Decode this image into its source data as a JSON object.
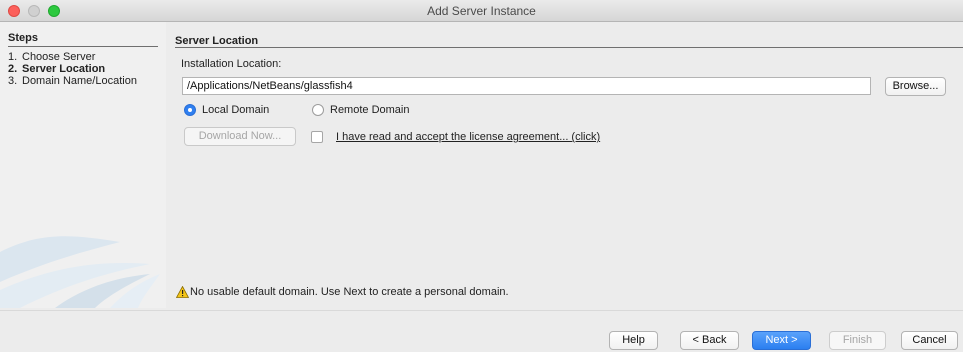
{
  "window": {
    "title": "Add Server Instance"
  },
  "steps": {
    "heading": "Steps",
    "items": [
      {
        "num": "1.",
        "label": "Choose Server"
      },
      {
        "num": "2.",
        "label": "Server Location"
      },
      {
        "num": "3.",
        "label": "Domain Name/Location"
      }
    ],
    "current_index": 1
  },
  "panel": {
    "title": "Server Location",
    "install_label": "Installation Location:",
    "install_path": "/Applications/NetBeans/glassfish4",
    "browse_label": "Browse...",
    "local_domain_label": "Local Domain",
    "remote_domain_label": "Remote Domain",
    "selected_domain": "Local Domain",
    "download_label": "Download Now...",
    "license_link": "I have read and accept the license agreement... (click)",
    "license_accepted": false,
    "warning": "No usable default domain. Use Next to create a personal domain."
  },
  "footer": {
    "help": "Help",
    "back": "< Back",
    "next": "Next >",
    "finish": "Finish",
    "cancel": "Cancel"
  },
  "icons": [
    "warning-icon"
  ],
  "colors": {
    "accent": "#2f7ff0",
    "close": "#fc605b",
    "maximize": "#2dc93f"
  }
}
